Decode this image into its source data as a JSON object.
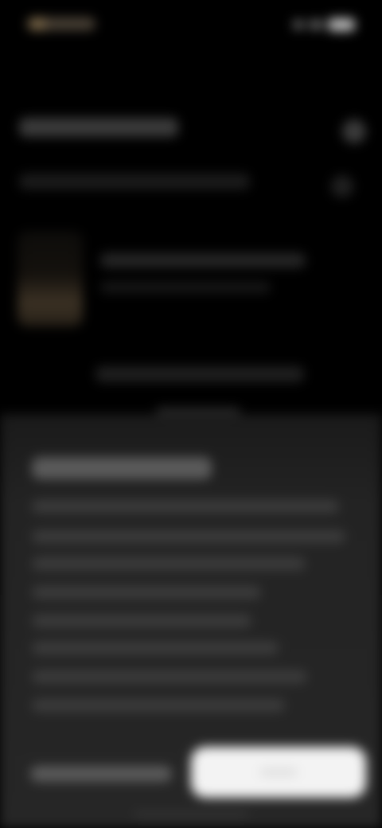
{
  "status_bar": {
    "time_icon": "clock-placeholder",
    "battery_icon": "battery-icon"
  },
  "header": {
    "close_icon": "close-icon"
  },
  "media": {},
  "sheet": {}
}
